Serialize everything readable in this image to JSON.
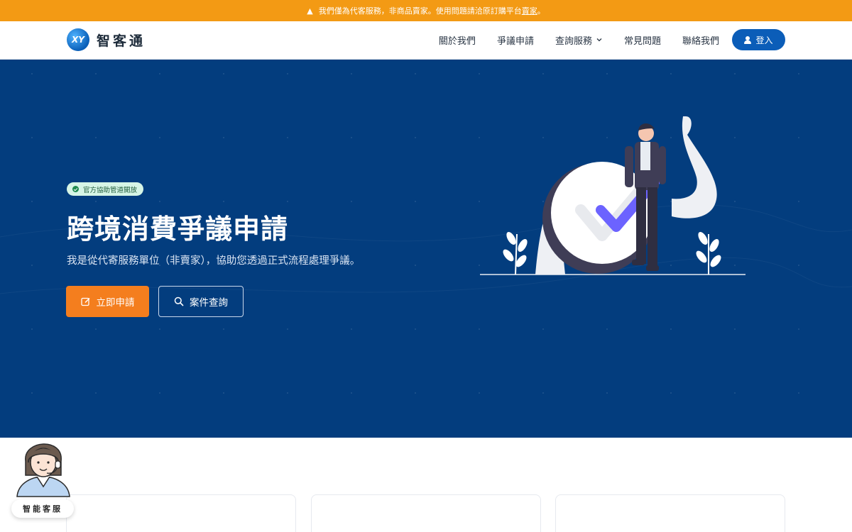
{
  "notice": {
    "icon": "warning-icon",
    "text_before": "我們僅為代客服務，非商品賣家。使用問題請洽原訂購平台",
    "link": "賣家",
    "text_after": "。",
    "bg_color": "#f39a14"
  },
  "header": {
    "logo_mark": "XY",
    "logo_text": "智客通",
    "menu": [
      {
        "label": "關於我們"
      },
      {
        "label": "爭議申請"
      },
      {
        "label": "查詢服務",
        "icon": "chevron-down-icon"
      },
      {
        "label": "常見問題"
      },
      {
        "label": "聯絡我們"
      }
    ],
    "login_label": "登入",
    "login_icon": "user-icon",
    "accent_color": "#0b5db8"
  },
  "hero": {
    "badge": "官方協助管道開放",
    "title": "跨境消費爭議申請",
    "subtitle": "我是從代寄服務單位（非賣家），協助您透過正式流程處理爭議。",
    "primary_button": "立即申請",
    "primary_icon": "edit-icon",
    "secondary_button": "案件查詢",
    "secondary_icon": "search-icon",
    "bg_color": "#033d7e",
    "primary_color": "#f47e1e"
  },
  "assistant": {
    "label": "智能客服",
    "icon": "support-agent-avatar"
  }
}
